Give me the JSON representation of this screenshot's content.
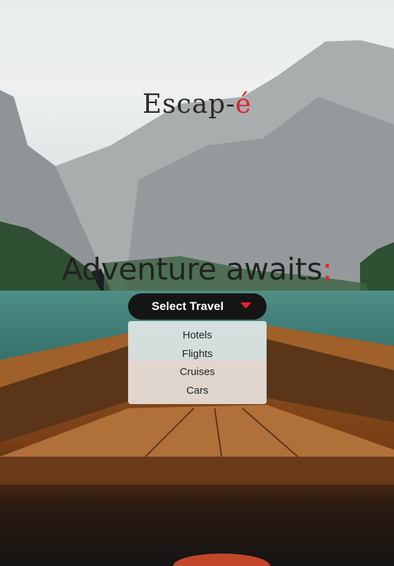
{
  "brand": {
    "name_main": "Escap-",
    "name_accent": "é"
  },
  "hero": {
    "headline": "Adventure awaits",
    "headline_accent": ":"
  },
  "travel_select": {
    "label": "Select Travel",
    "options": [
      "Hotels",
      "Flights",
      "Cruises",
      "Cars"
    ]
  },
  "colors": {
    "accent": "#e0222a",
    "button_bg": "#151515",
    "text_dark": "#222222"
  },
  "icons": {
    "dropdown": "triangle-down-icon"
  }
}
